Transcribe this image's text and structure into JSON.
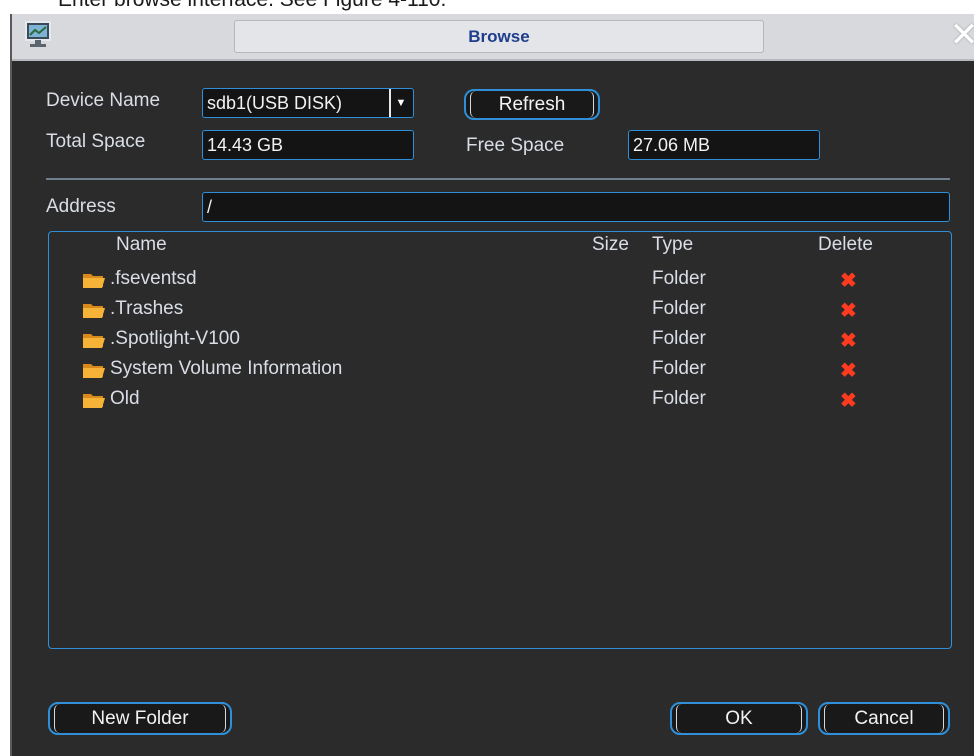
{
  "caption": "Enter browse interface. See Figure 4-110.",
  "window": {
    "title": "Browse"
  },
  "icons": {
    "app": "monitor-icon",
    "close": "close-icon",
    "folder": "folder-icon",
    "delete": "delete-x-icon"
  },
  "colors": {
    "accent": "#2f8fd8",
    "title_text": "#1e3d8c",
    "delete": "#ff3b1f",
    "background": "#2b2b2b"
  },
  "device": {
    "name_label": "Device Name",
    "name_value": "sdb1(USB DISK)",
    "total_label": "Total Space",
    "total_value": "14.43 GB",
    "free_label": "Free Space",
    "free_value": "27.06 MB",
    "refresh_label": "Refresh"
  },
  "address": {
    "label": "Address",
    "value": "/"
  },
  "table": {
    "columns": {
      "name": "Name",
      "size": "Size",
      "type": "Type",
      "delete": "Delete"
    },
    "rows": [
      {
        "name": ".fseventsd",
        "size": "",
        "type": "Folder"
      },
      {
        "name": ".Trashes",
        "size": "",
        "type": "Folder"
      },
      {
        "name": ".Spotlight-V100",
        "size": "",
        "type": "Folder"
      },
      {
        "name": "System Volume Information",
        "size": "",
        "type": "Folder"
      },
      {
        "name": "Old",
        "size": "",
        "type": "Folder"
      }
    ]
  },
  "buttons": {
    "new_folder": "New Folder",
    "ok": "OK",
    "cancel": "Cancel"
  }
}
